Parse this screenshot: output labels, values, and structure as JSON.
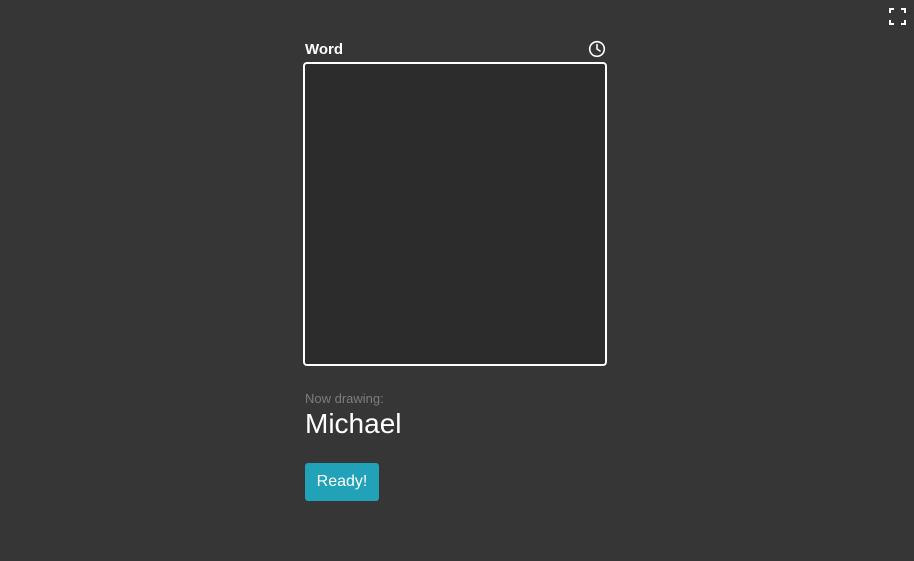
{
  "header": {
    "word_label": "Word",
    "timer_icon": "clock-icon"
  },
  "toolbar": {
    "fullscreen_icon": "fullscreen-icon"
  },
  "status": {
    "now_drawing_label": "Now drawing:",
    "drawer_name": "Michael"
  },
  "actions": {
    "ready_label": "Ready!"
  },
  "colors": {
    "background": "#363636",
    "canvas": "#2c2c2c",
    "accent": "#22a2b8",
    "muted_text": "#7d7d7d"
  }
}
